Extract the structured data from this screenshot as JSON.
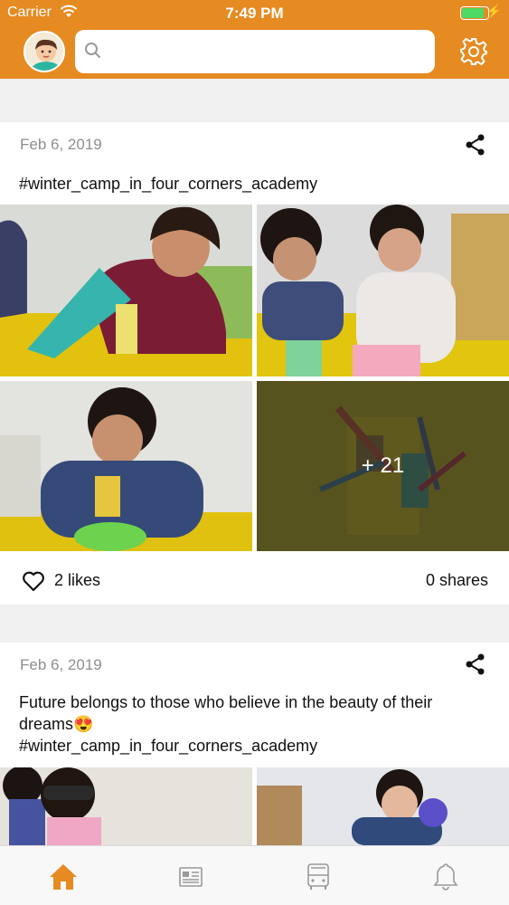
{
  "status_bar": {
    "carrier": "Carrier",
    "time": "7:49 PM",
    "battery_level": 0.9
  },
  "header": {
    "avatar_icon": "child-avatar-icon",
    "search_placeholder": "",
    "settings_icon": "gear-icon",
    "bar_color": "#e68a22"
  },
  "posts": [
    {
      "date": "Feb 6, 2019",
      "text": "#winter_camp_in_four_corners_academy",
      "photos_more": "+ 21",
      "likes": "2 likes",
      "shares": "0 shares"
    },
    {
      "date": "Feb 6, 2019",
      "text": " Future belongs to those who believe in the beauty of their dreams😍\n#winter_camp_in_four_corners_academy"
    }
  ],
  "tabs": [
    {
      "icon": "home-icon",
      "active": true
    },
    {
      "icon": "news-icon",
      "active": false
    },
    {
      "icon": "bus-icon",
      "active": false
    },
    {
      "icon": "bell-icon",
      "active": false
    }
  ]
}
